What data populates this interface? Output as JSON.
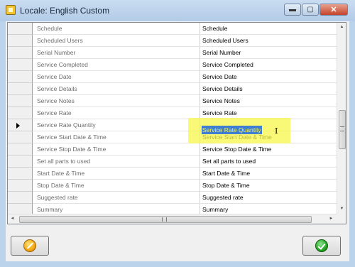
{
  "window": {
    "title": "Locale: English Custom",
    "controls": {
      "minimize": "▬",
      "maximize": "▢",
      "close": "✕"
    }
  },
  "grid": {
    "rows": [
      {
        "name": "Schedule",
        "value": "Schedule"
      },
      {
        "name": "Scheduled Users",
        "value": "Scheduled Users"
      },
      {
        "name": "Serial Number",
        "value": "Serial Number"
      },
      {
        "name": "Service Completed",
        "value": "Service Completed"
      },
      {
        "name": "Service Date",
        "value": "Service Date"
      },
      {
        "name": "Service Details",
        "value": "Service Details"
      },
      {
        "name": "Service Notes",
        "value": "Service Notes"
      },
      {
        "name": "Service Rate",
        "value": "Service Rate"
      },
      {
        "name": "Service Rate Quantity",
        "value": "Service Rate Quantity"
      },
      {
        "name": "Service Start Date & Time",
        "value": "Service Start Date & Time"
      },
      {
        "name": "Service Stop Date & Time",
        "value": "Service Stop Date & Time"
      },
      {
        "name": "Set all parts to used",
        "value": "Set all parts to used"
      },
      {
        "name": "Start Date & Time",
        "value": "Start Date & Time"
      },
      {
        "name": "Stop Date & Time",
        "value": "Stop Date & Time"
      },
      {
        "name": "Suggested rate",
        "value": "Suggested rate"
      },
      {
        "name": "Summary",
        "value": "Summary"
      }
    ],
    "current_row_index": 8,
    "editing_value": "Service Rate Quantity"
  },
  "scroll": {
    "up": "▲",
    "down": "▼",
    "left": "◄",
    "right": "►"
  },
  "icons": {
    "app": "app-icon",
    "cancel": "cancel-icon",
    "ok": "ok-icon",
    "text_cursor": "text-cursor-icon"
  },
  "colors": {
    "highlight": "#f7f54a",
    "selection": "#3f7ed1"
  }
}
